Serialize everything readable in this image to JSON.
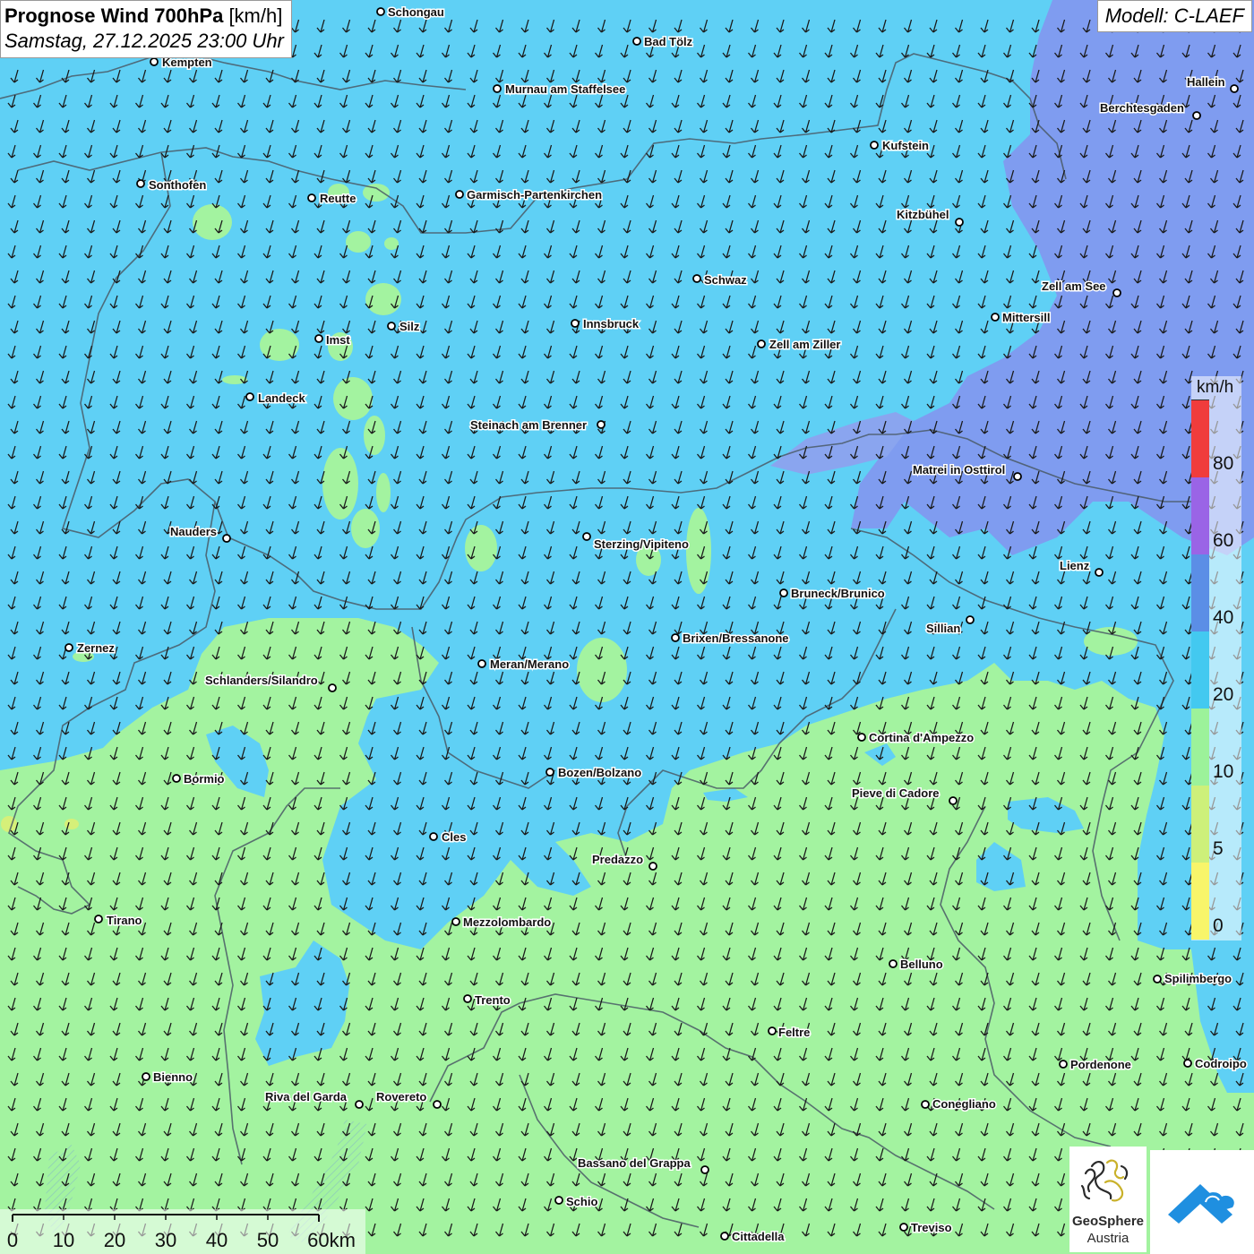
{
  "header": {
    "title_bold": "Prognose Wind 700hPa",
    "title_unit": "[km/h]",
    "datetime": "Samstag, 27.12.2025 23:00 Uhr",
    "model": "Modell: C-LAEF"
  },
  "legend": {
    "unit": "km/h",
    "labels": [
      "0",
      "5",
      "10",
      "20",
      "40",
      "60",
      "80"
    ],
    "colors": [
      "#f8f56a",
      "#cdf07a",
      "#9cf29a",
      "#43c9f0",
      "#5b8ee6",
      "#9a64e6",
      "#f03c3c"
    ]
  },
  "scale_bar": {
    "labels": [
      "0",
      "10",
      "20",
      "30",
      "40",
      "50",
      "60km"
    ]
  },
  "logos": {
    "geosphere_line1": "GeoSphere",
    "geosphere_line2": "Austria"
  },
  "cities": [
    {
      "name": "Schongau",
      "icon": "city-marker"
    },
    {
      "name": "Bad Tölz",
      "icon": "city-marker"
    },
    {
      "name": "Kempten",
      "icon": "city-marker"
    },
    {
      "name": "Murnau am Staffelsee",
      "icon": "city-marker"
    },
    {
      "name": "Hallein",
      "icon": "city-marker"
    },
    {
      "name": "Berchtesgaden",
      "icon": "city-marker"
    },
    {
      "name": "Kufstein",
      "icon": "city-marker"
    },
    {
      "name": "Sonthofen",
      "icon": "city-marker"
    },
    {
      "name": "Reutte",
      "icon": "city-marker"
    },
    {
      "name": "Garmisch-Partenkirchen",
      "icon": "city-marker"
    },
    {
      "name": "Kitzbühel",
      "icon": "city-marker"
    },
    {
      "name": "Schwaz",
      "icon": "city-marker"
    },
    {
      "name": "Zell am See",
      "icon": "city-marker"
    },
    {
      "name": "Mittersill",
      "icon": "city-marker"
    },
    {
      "name": "Imst",
      "icon": "city-marker"
    },
    {
      "name": "Silz",
      "icon": "city-marker"
    },
    {
      "name": "Innsbruck",
      "icon": "city-marker"
    },
    {
      "name": "Zell am Ziller",
      "icon": "city-marker"
    },
    {
      "name": "Landeck",
      "icon": "city-marker"
    },
    {
      "name": "Steinach am Brenner",
      "icon": "city-marker"
    },
    {
      "name": "Matrei in Osttirol",
      "icon": "city-marker"
    },
    {
      "name": "Nauders",
      "icon": "city-marker"
    },
    {
      "name": "Sterzing/Vipiteno",
      "icon": "city-marker"
    },
    {
      "name": "Lienz",
      "icon": "city-marker"
    },
    {
      "name": "Bruneck/Brunico",
      "icon": "city-marker"
    },
    {
      "name": "Sillian",
      "icon": "city-marker"
    },
    {
      "name": "Brixen/Bressanone",
      "icon": "city-marker"
    },
    {
      "name": "Zernez",
      "icon": "city-marker"
    },
    {
      "name": "Meran/Merano",
      "icon": "city-marker"
    },
    {
      "name": "Schlanders/Silandro",
      "icon": "city-marker"
    },
    {
      "name": "Cortina d'Ampezzo",
      "icon": "city-marker"
    },
    {
      "name": "Bozen/Bolzano",
      "icon": "city-marker"
    },
    {
      "name": "Bormio",
      "icon": "city-marker"
    },
    {
      "name": "Pieve di Cadore",
      "icon": "city-marker"
    },
    {
      "name": "Cles",
      "icon": "city-marker"
    },
    {
      "name": "Predazzo",
      "icon": "city-marker"
    },
    {
      "name": "Tirano",
      "icon": "city-marker"
    },
    {
      "name": "Mezzolombardo",
      "icon": "city-marker"
    },
    {
      "name": "Belluno",
      "icon": "city-marker"
    },
    {
      "name": "Spilimbergo",
      "icon": "city-marker"
    },
    {
      "name": "Trento",
      "icon": "city-marker"
    },
    {
      "name": "Feltre",
      "icon": "city-marker"
    },
    {
      "name": "Pordenone",
      "icon": "city-marker"
    },
    {
      "name": "Codroipo",
      "icon": "city-marker"
    },
    {
      "name": "Bienno",
      "icon": "city-marker"
    },
    {
      "name": "Riva del Garda",
      "icon": "city-marker"
    },
    {
      "name": "Rovereto",
      "icon": "city-marker"
    },
    {
      "name": "Conegliano",
      "icon": "city-marker"
    },
    {
      "name": "Bassano del Grappa",
      "icon": "city-marker"
    },
    {
      "name": "Schio",
      "icon": "city-marker"
    },
    {
      "name": "Treviso",
      "icon": "city-marker"
    },
    {
      "name": "Cittadella",
      "icon": "city-marker"
    }
  ],
  "wind": {
    "direction_from": "NNE",
    "arrow_icon": "wind-arrow-icon"
  }
}
